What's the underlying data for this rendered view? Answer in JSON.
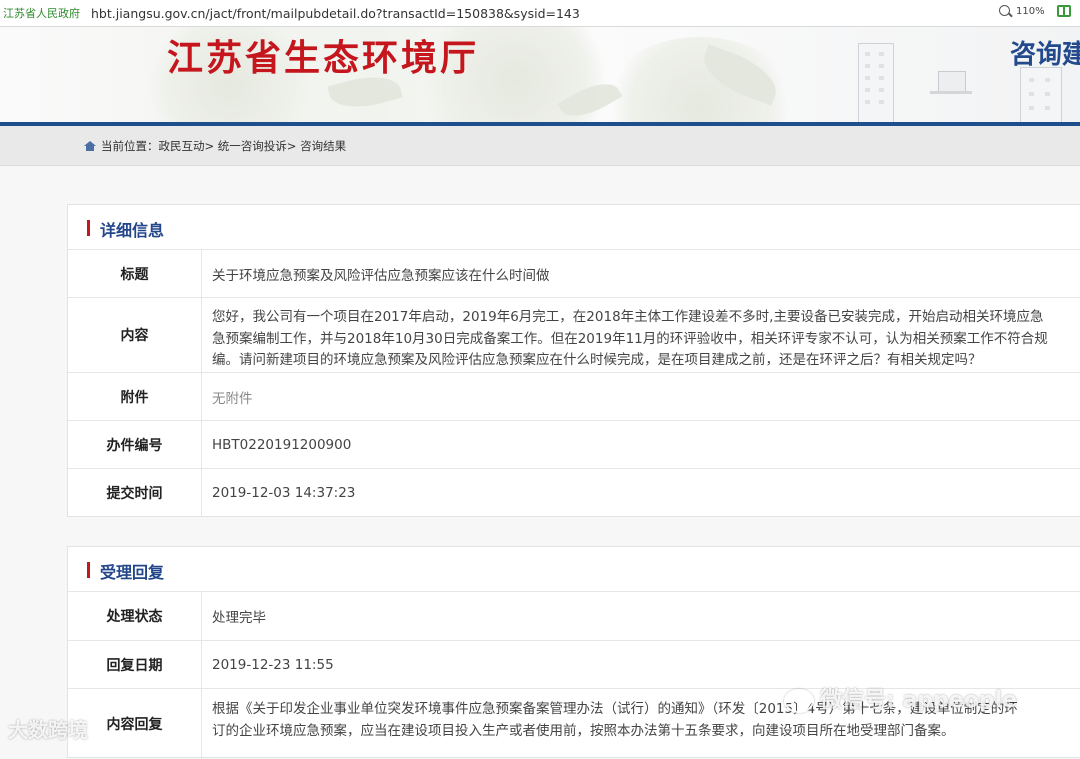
{
  "browser": {
    "site_tag": "江苏省人民政府",
    "url": "hbt.jiangsu.gov.cn/jact/front/mailpubdetail.do?transactId=150838&sysid=143",
    "zoom": "110%",
    "icons": [
      "zoom-icon",
      "reading-mode-icon"
    ]
  },
  "banner": {
    "title": "江苏省生态环境厅",
    "right_text": "咨询建"
  },
  "breadcrumb": {
    "prefix": "当前位置：",
    "items": [
      "政民互动",
      "统一咨询投诉",
      "咨询结果"
    ],
    "sep": ">"
  },
  "details": {
    "title": "详细信息",
    "rows": {
      "subject": {
        "label": "标题",
        "value": "关于环境应急预案及风险评估应急预案应该在什么时间做"
      },
      "content": {
        "label": "内容",
        "lines": [
          "您好，我公司有一个项目在2017年启动，2019年6月完工，在2018年主体工作建设差不多时,主要设备已安装完成，开始启动相关环境应急",
          "急预案编制工作，并与2018年10月30日完成备案工作。但在2019年11月的环评验收中，相关环评专家不认可，认为相关预案工作不符合规",
          "编。请问新建项目的环境应急预案及风险评估应急预案应在什么时候完成，是在项目建成之前，还是在环评之后？有相关规定吗？"
        ]
      },
      "attachment": {
        "label": "附件",
        "value": "无附件"
      },
      "case_no": {
        "label": "办件编号",
        "value": "HBT0220191200900"
      },
      "submit_time": {
        "label": "提交时间",
        "value": "2019-12-03 14:37:23"
      }
    }
  },
  "reply": {
    "title": "受理回复",
    "rows": {
      "status": {
        "label": "处理状态",
        "value": "处理完毕"
      },
      "reply_date": {
        "label": "回复日期",
        "value": "2019-12-23 11:55"
      },
      "reply_content": {
        "label": "内容回复",
        "lines": [
          "根据《关于印发企业事业单位突发环境事件应急预案备案管理办法（试行）的通知》（环发〔2015〕4号）第十七条，建设单位制定的环",
          "订的企业环境应急预案，应当在建设项目投入生产或者使用前，按照本办法第十五条要求，向建设项目所在地受理部门备案。"
        ]
      }
    }
  },
  "watermarks": {
    "left": "大数跨境",
    "right": "微信号: appeople"
  },
  "colors": {
    "brand_red": "#c4161c",
    "brand_blue": "#1d4f8c",
    "heading_blue": "#23468a"
  }
}
